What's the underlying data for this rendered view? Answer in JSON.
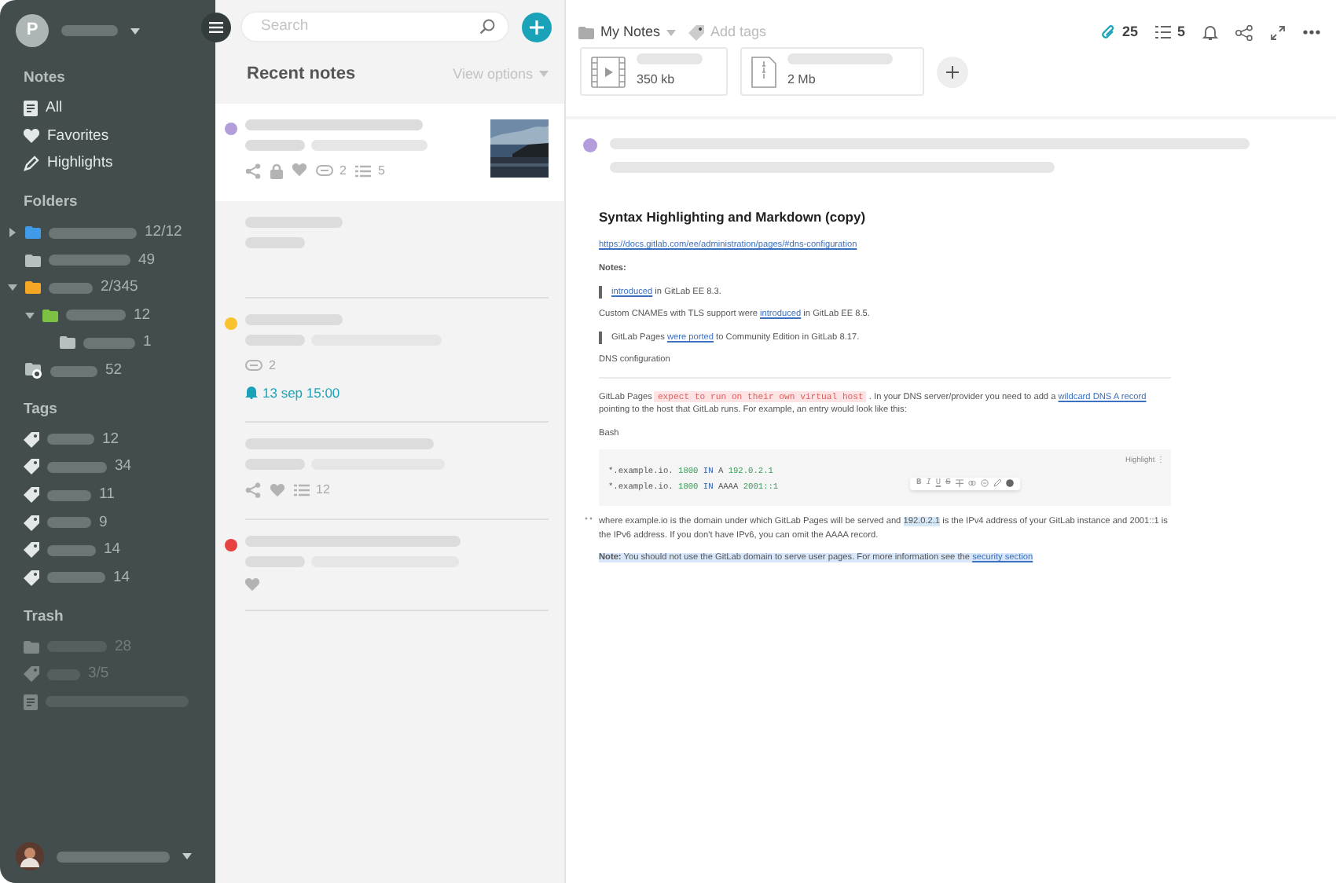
{
  "sidebar": {
    "account": {
      "initial": "P"
    },
    "notes": {
      "title": "Notes",
      "items": [
        {
          "kind": "all",
          "label": "All"
        },
        {
          "kind": "favorites",
          "label": "Favorites"
        },
        {
          "kind": "highlights",
          "label": "Highlights"
        }
      ]
    },
    "folders": {
      "title": "Folders",
      "items": [
        {
          "kind": "folder",
          "color": "#3f9ae8",
          "count": "12/12",
          "expanded": false
        },
        {
          "kind": "folder",
          "color": "#b8bfbf",
          "count": "49"
        },
        {
          "kind": "folder",
          "color": "#f5a623",
          "count": "2/345",
          "expanded": true,
          "children": [
            {
              "kind": "folder",
              "color": "#7cc142",
              "count": "12",
              "expanded": true,
              "children": [
                {
                  "kind": "folder",
                  "color": "#b8bfbf",
                  "count": "1"
                }
              ]
            }
          ]
        },
        {
          "kind": "shared",
          "color": "#b8bfbf",
          "count": "52"
        }
      ]
    },
    "tags": {
      "title": "Tags",
      "items": [
        {
          "count": "12"
        },
        {
          "count": "34"
        },
        {
          "count": "11"
        },
        {
          "count": "9"
        },
        {
          "count": "14"
        },
        {
          "count": "14"
        }
      ]
    },
    "trash": {
      "title": "Trash",
      "items": [
        {
          "kind": "folder",
          "count": "28"
        },
        {
          "kind": "tag",
          "count": "3/5"
        },
        {
          "kind": "note"
        }
      ]
    }
  },
  "note_list": {
    "search": {
      "placeholder": "Search"
    },
    "title": "Recent notes",
    "view_options": "View options",
    "notes": [
      {
        "selected": true,
        "color": "#b39ddb",
        "thumbnail": true,
        "meta": [
          {
            "kind": "share"
          },
          {
            "kind": "lock"
          },
          {
            "kind": "heart"
          },
          {
            "kind": "attachments",
            "count": "2"
          },
          {
            "kind": "checklist",
            "count": "5"
          }
        ]
      },
      {
        "selected": false
      },
      {
        "selected": false,
        "color": "#f9c22e",
        "meta": [
          {
            "kind": "attachments",
            "count": "2"
          }
        ],
        "reminder": "13 sep 15:00"
      },
      {
        "selected": false,
        "meta": [
          {
            "kind": "share"
          },
          {
            "kind": "heart"
          },
          {
            "kind": "checklist",
            "count": "12"
          }
        ]
      },
      {
        "selected": false,
        "color": "#e84141",
        "meta": [
          {
            "kind": "heart"
          }
        ]
      }
    ]
  },
  "editor": {
    "folder": "My Notes",
    "tags_placeholder": "Add tags",
    "attachments_count": "25",
    "checklist_count": "5",
    "attachments": [
      {
        "kind": "video",
        "size": "350 kb"
      },
      {
        "kind": "archive",
        "size": "2 Mb"
      }
    ],
    "color": "#b39ddb",
    "document": [
      {
        "kind": "heading",
        "segments": [
          {
            "kind": "text",
            "text": "Syntax Highlighting and Markdown (copy)"
          }
        ]
      },
      {
        "kind": "text",
        "segments": [
          {
            "kind": "link",
            "text": "https://docs.gitlab.com/ee/administration/pages/#dns-configuration"
          }
        ]
      },
      {
        "kind": "text",
        "segments": [
          {
            "kind": "bold",
            "text": "Notes:"
          }
        ]
      },
      {
        "kind": "quote",
        "segments": [
          {
            "kind": "link",
            "text": "introduced"
          },
          {
            "kind": "text",
            "text": " in GitLab EE 8.3."
          }
        ]
      },
      {
        "kind": "text",
        "segments": [
          {
            "kind": "text",
            "text": "Custom CNAMEs with TLS support were "
          },
          {
            "kind": "link",
            "text": "introduced"
          },
          {
            "kind": "text",
            "text": " in GitLab EE 8.5."
          }
        ]
      },
      {
        "kind": "quote",
        "segments": [
          {
            "kind": "text",
            "text": "GitLab Pages "
          },
          {
            "kind": "link",
            "text": "were ported"
          },
          {
            "kind": "text",
            "text": " to Community Edition in GitLab 8.17."
          }
        ]
      },
      {
        "kind": "text",
        "segments": [
          {
            "kind": "text",
            "text": "DNS configuration"
          }
        ]
      },
      {
        "kind": "rule"
      },
      {
        "kind": "text",
        "segments": [
          {
            "kind": "text",
            "text": "GitLab Pages "
          },
          {
            "kind": "code",
            "text": "expect to run on their own virtual host"
          },
          {
            "kind": "text",
            "text": " . In your DNS server/provider you need to add a "
          },
          {
            "kind": "link",
            "text": "wildcard DNS A record"
          },
          {
            "kind": "text",
            "text": " pointing to the host that GitLab runs. For example, an entry would look like this:"
          }
        ]
      },
      {
        "kind": "text",
        "segments": [
          {
            "kind": "text",
            "text": "Bash"
          }
        ]
      },
      {
        "kind": "codeblock",
        "label": "Highlight",
        "menu": "⋮",
        "lines": [
          [
            {
              "kind": "plain",
              "text": "*.example.io. "
            },
            {
              "kind": "num",
              "text": "1800"
            },
            {
              "kind": "kw",
              "text": " IN "
            },
            {
              "kind": "plain",
              "text": "A "
            },
            {
              "kind": "num",
              "text": "192.0.2.1"
            }
          ],
          [
            {
              "kind": "plain",
              "text": "*.example.io. "
            },
            {
              "kind": "num",
              "text": "1800"
            },
            {
              "kind": "kw",
              "text": " IN "
            },
            {
              "kind": "plain",
              "text": "AAAA "
            },
            {
              "kind": "num",
              "text": "2001::1"
            }
          ]
        ],
        "format_bar": [
          "B",
          "I",
          "U",
          "S"
        ]
      },
      {
        "kind": "text",
        "hovered": true,
        "segments": [
          {
            "kind": "text",
            "text": "where example.io is the domain under which GitLab Pages will be served and "
          },
          {
            "kind": "mark",
            "text": "192.0.2.1"
          },
          {
            "kind": "text",
            "text": " is the IPv4 address of your GitLab instance and 2001::1 is the IPv6 address. If you don't have IPv6, you can omit the AAAA record."
          }
        ]
      },
      {
        "kind": "note",
        "segments": [
          {
            "kind": "bold",
            "text": "Note:"
          },
          {
            "kind": "text",
            "text": " You should not use the GitLab domain to serve user pages. For more information see the "
          },
          {
            "kind": "link",
            "text": "security section"
          }
        ]
      }
    ]
  }
}
